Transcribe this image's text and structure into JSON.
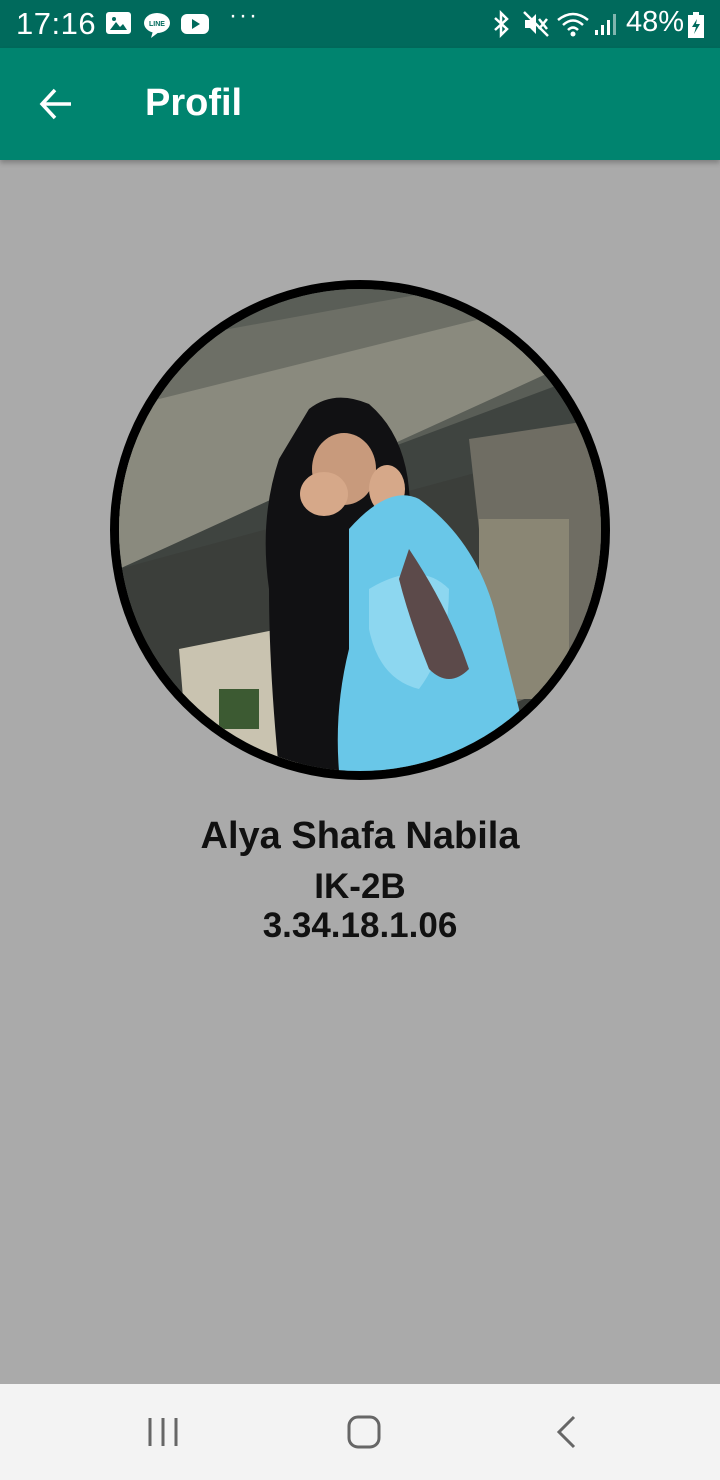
{
  "status_bar": {
    "time": "17:16",
    "battery_percent": "48%",
    "icons": [
      "gallery-icon",
      "line-icon",
      "youtube-icon",
      "more-dots-icon",
      "bluetooth-icon",
      "mute-icon",
      "wifi-icon",
      "signal-icon",
      "battery-icon"
    ],
    "more_dots": "···"
  },
  "app_bar": {
    "title": "Profil",
    "background": "#00846f",
    "status_background": "#006a5c"
  },
  "profile": {
    "name": "Alya Shafa Nabila",
    "class": "IK-2B",
    "nim": "3.34.18.1.06"
  },
  "nav_bar": {
    "icons": [
      "recent-apps-icon",
      "home-icon",
      "back-nav-icon"
    ]
  },
  "colors": {
    "page_background": "#aaaaaa",
    "nav_background": "#f3f3f3"
  }
}
